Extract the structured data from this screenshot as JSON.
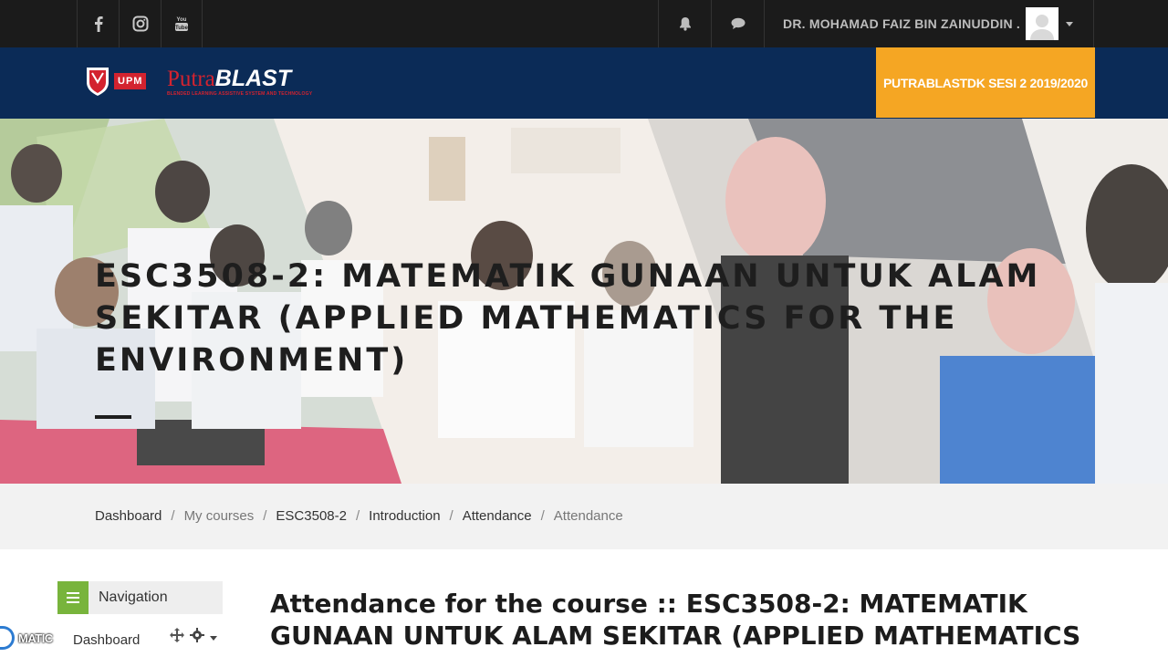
{
  "topbar": {
    "social": [
      {
        "icon": "facebook-icon",
        "glyph": "f"
      },
      {
        "icon": "instagram-icon",
        "glyph": ""
      },
      {
        "icon": "youtube-icon",
        "glyph": ""
      }
    ],
    "notifications_icon": "bell-icon",
    "messages_icon": "chat-icon",
    "user_name": "DR. MOHAMAD FAIZ BIN ZAINUDDIN ."
  },
  "brand": {
    "upm_badge": "UPM",
    "putra_part1": "Putra",
    "putra_part2": "BLAST",
    "putra_tagline": "BLENDED LEARNING ASSISTIVE SYSTEM AND TECHNOLOGY",
    "session_label": "PUTRABLASTDK SESI 2 2019/2020"
  },
  "hero": {
    "course_title": "ESC3508-2: MATEMATIK GUNAAN UNTUK ALAM SEKITAR (APPLIED MATHEMATICS FOR THE ENVIRONMENT)"
  },
  "breadcrumb": [
    {
      "label": "Dashboard",
      "link": true
    },
    {
      "label": "My courses",
      "link": false
    },
    {
      "label": "ESC3508-2",
      "link": true
    },
    {
      "label": "Introduction",
      "link": true
    },
    {
      "label": "Attendance",
      "link": true
    },
    {
      "label": "Attendance",
      "link": false
    }
  ],
  "navigation": {
    "title": "Navigation",
    "first_item": "Dashboard"
  },
  "overlay": {
    "matic_label": "MATIC"
  },
  "main": {
    "heading": "Attendance for the course :: ESC3508-2: MATEMATIK GUNAAN UNTUK ALAM SEKITAR (APPLIED MATHEMATICS"
  },
  "colors": {
    "topbar": "#1b1b1b",
    "brandbar": "#0b2b57",
    "session": "#f5a623",
    "nav_icon": "#78b43c"
  }
}
